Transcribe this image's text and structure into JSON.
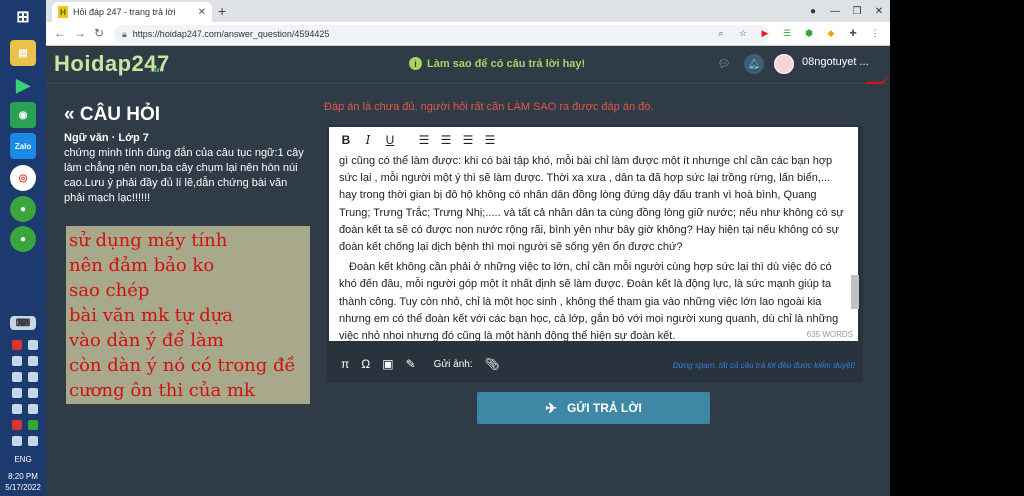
{
  "taskbar": {
    "lang": "ENG",
    "time": "8:20 PM",
    "date": "5/17/2022"
  },
  "browser": {
    "tab_title": "Hỏi đáp 247 - trang trả lời",
    "url": "https://hoidap247.com/answer_question/4594425"
  },
  "header": {
    "logo": "Hoidap247",
    "logo_sub": ".com",
    "hint": "Làm sao để có câu trả lời hay!",
    "username": "08ngotuyet ..."
  },
  "question": {
    "heading": "« CÂU HỎI",
    "subject": "Ngữ văn · Lớp 7",
    "text": "chứng minh tính đúng đắn của câu tục ngữ:1 cây làm chẳng nên non,ba cây chụm lại nên hòn núi cao.Lưu ý phải đầy đủ lí lẽ,dẫn chứng bài văn phải mạch lạc!!!!!!"
  },
  "note_lines": [
    "sử dụng máy tính",
    "nên đảm bảo ko",
    "sao chép",
    "bài văn mk tự dựa",
    "vào dàn ý để làm",
    "còn dàn ý nó có trong đề",
    "cương ôn thi của mk"
  ],
  "answer": {
    "warning": "Đáp án là chưa đủ, người hỏi rất cần LÀM SAO ra được đáp án đó.",
    "para1": "gì cũng có thể làm được: khi có bài tập khó, mỗi bài chỉ làm được một ít nhưnge chỉ cần các bạn hợp sức lại , mỗi người một ý thì sẽ làm được. Thời xa xưa , dân ta đã hợp sức lại trồng rừng, lấn biển,... hay trong thời gian bị đô hộ không có nhân dân đồng lòng đứng dậy đấu tranh vì hoà bình, Quang Trung; Trưng Trắc; Trưng Nhị;..... và tất cả nhân dân ta cùng đồng lòng giữ nước; nếu như không có sự đoàn kết ta sẽ có được non nước rộng rãi, bình yên như bây giờ không? Hay hiện tại nếu không có sự đoàn kết chống lại dịch bệnh thì mọi người sẽ sống yên ổn được chứ?",
    "para2": "Đoàn kết không cần phải ở những việc to lớn, chỉ cần mỗi người cùng hợp sức lại thì dù việc đó có khó đến đâu, mỗi người góp một ít nhất định sẽ làm được. Đoàn kết là động lực, là sức mạnh giúp ta thành công. Tuy còn nhỏ, chỉ là một học sinh , không thể tham gia vào những việc lớn lao ngoài kia nhưng em có thể đoàn kết với các bạn học, cả lớp, gắn bó với mọi người xung quanh, dù chỉ là những việc nhỏ nhoi nhưng đó cũng là một hành động thể hiện sự đoàn kết.",
    "word_count": "635 WORDS",
    "attach_label": "Gửi ảnh:",
    "spam_note": "Đừng spam, tất cả câu trả lời đều được kiểm duyệt!",
    "submit_label": "GỬI TRẢ LỜI"
  },
  "toolbar_icons": [
    "bold-icon",
    "italic-icon",
    "underline-icon",
    "align-left-icon",
    "align-center-icon",
    "align-right-icon",
    "align-justify-icon"
  ]
}
